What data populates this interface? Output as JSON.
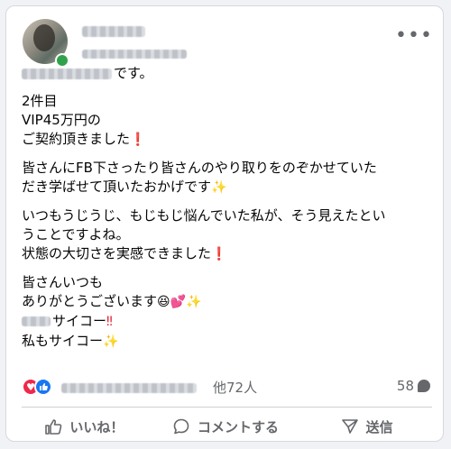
{
  "post": {
    "suffix_text": "です。",
    "paragraphs": {
      "p1": {
        "line1": "2件目",
        "line2": "VIP45万円の",
        "line3": "ご契約頂きました"
      },
      "p2": {
        "line1": "皆さんにFB下さったり皆さんのやり取りをのぞかせていた",
        "line2": "だき学ばせて頂いたおかげです"
      },
      "p3": {
        "line1": "いつもうじうじ、もじもじ悩んでいた私が、そう見えたとい",
        "line2": "うことですよね。",
        "line3": "状態の大切さを実感できました"
      },
      "p4": {
        "line1": "皆さんいつも",
        "line2": "ありがとうございます",
        "line3": "サイコー",
        "line4": "私もサイコー"
      }
    },
    "emoji": {
      "exclamation": "❗",
      "double_exclamation": "‼",
      "sparkles": "✨",
      "laugh": "😆",
      "hearts": "💕"
    }
  },
  "reactions": {
    "others_text": "他72人",
    "comment_count": "58"
  },
  "actions": {
    "like": "いいね！",
    "comment": "コメントする",
    "send": "送信"
  },
  "header": {
    "more": "•••"
  },
  "colors": {
    "like_blue": "#1877f2",
    "love_red": "#f0284a",
    "online_green": "#31a24c",
    "muted": "#65676b"
  }
}
